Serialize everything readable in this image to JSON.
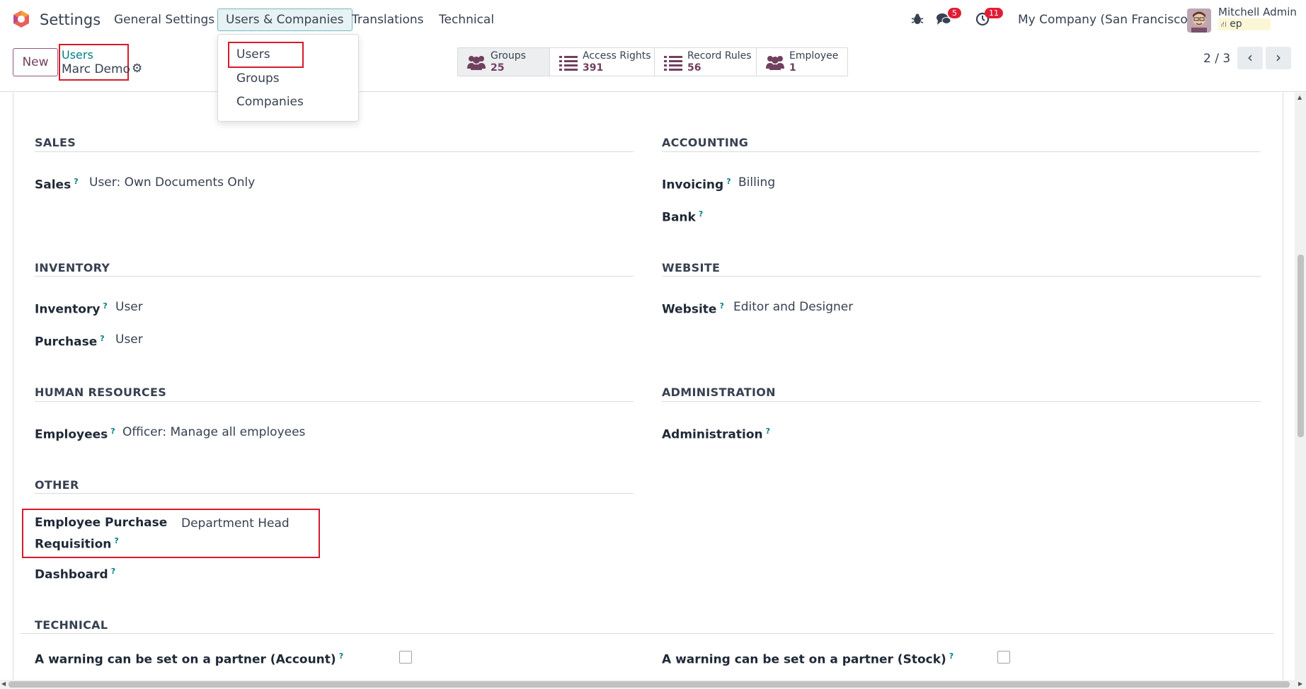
{
  "navbar": {
    "app_name": "Settings",
    "menu": [
      "General Settings",
      "Users & Companies",
      "Translations",
      "Technical"
    ],
    "messages_count": "5",
    "activities_count": "11",
    "company": "My Company (San Francisco)",
    "user_name": "Mitchell Admin",
    "database": "ep"
  },
  "dropdown": {
    "items": [
      "Users",
      "Groups",
      "Companies"
    ]
  },
  "control": {
    "new_label": "New",
    "breadcrumb_parent": "Users",
    "breadcrumb_current": "Marc Demo",
    "stats": [
      {
        "label": "Groups",
        "value": "25",
        "icon": "users-icon"
      },
      {
        "label": "Access Rights",
        "value": "391",
        "icon": "list-icon"
      },
      {
        "label": "Record Rules",
        "value": "56",
        "icon": "list-icon"
      },
      {
        "label": "Employee",
        "value": "1",
        "icon": "users-icon"
      }
    ],
    "pager": "2 / 3"
  },
  "sections": {
    "sales": {
      "title": "SALES",
      "fields": [
        {
          "label": "Sales",
          "value": "User: Own Documents Only"
        }
      ]
    },
    "accounting": {
      "title": "ACCOUNTING",
      "fields": [
        {
          "label": "Invoicing",
          "value": "Billing"
        },
        {
          "label": "Bank",
          "value": ""
        }
      ]
    },
    "inventory": {
      "title": "INVENTORY",
      "fields": [
        {
          "label": "Inventory",
          "value": "User"
        },
        {
          "label": "Purchase",
          "value": "User"
        }
      ]
    },
    "website": {
      "title": "WEBSITE",
      "fields": [
        {
          "label": "Website",
          "value": "Editor and Designer"
        }
      ]
    },
    "hr": {
      "title": "HUMAN RESOURCES",
      "fields": [
        {
          "label": "Employees",
          "value": "Officer: Manage all employees"
        }
      ]
    },
    "administration": {
      "title": "ADMINISTRATION",
      "fields": [
        {
          "label": "Administration",
          "value": ""
        }
      ]
    },
    "other": {
      "title": "OTHER",
      "fields": [
        {
          "label_line1": "Employee Purchase",
          "label_line2": "Requisition",
          "value": "Department Head"
        },
        {
          "label": "Dashboard",
          "value": ""
        }
      ]
    },
    "technical": {
      "title": "TECHNICAL",
      "fields": [
        {
          "label": "A warning can be set on a partner (Account)",
          "checked": false
        },
        {
          "label": "A warning can be set on a partner (Stock)",
          "checked": false
        }
      ]
    }
  },
  "colors": {
    "accent": "#71405f",
    "link": "#017e84",
    "highlight": "#d61a2a"
  }
}
